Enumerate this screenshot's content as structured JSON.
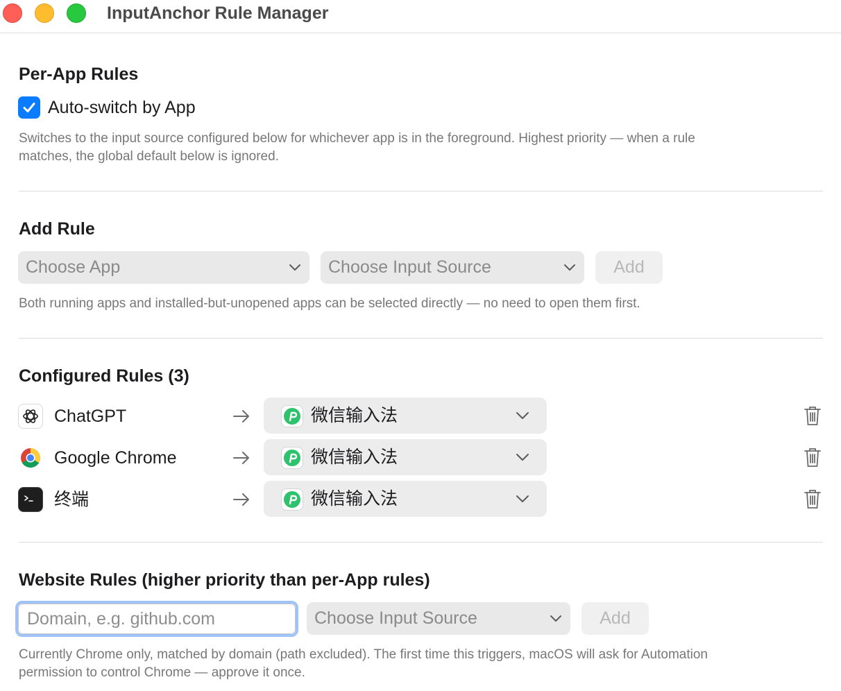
{
  "window": {
    "title": "InputAnchor Rule Manager"
  },
  "per_app": {
    "heading": "Per-App Rules",
    "checkbox_label": "Auto-switch by App",
    "checkbox_checked": true,
    "description_line1": "Switches to the input source configured below for whichever app is in the foreground. Highest priority — when a rule",
    "description_line2": "matches, the global default below is ignored."
  },
  "add_rule": {
    "heading": "Add Rule",
    "app_select": "Choose App",
    "source_select": "Choose Input Source",
    "add_label": "Add",
    "hint": "Both running apps and installed-but-unopened apps can be selected directly — no need to open them first."
  },
  "configured": {
    "heading": "Configured Rules (3)",
    "rules": [
      {
        "app": "ChatGPT",
        "icon": "chatgpt-icon",
        "source": "微信输入法"
      },
      {
        "app": "Google Chrome",
        "icon": "chrome-icon",
        "source": "微信输入法"
      },
      {
        "app": "终端",
        "icon": "terminal-icon",
        "source": "微信输入法"
      }
    ]
  },
  "website": {
    "heading": "Website Rules (higher priority than per-App rules)",
    "domain_placeholder": "Domain, e.g. github.com",
    "source_select": "Choose Input Source",
    "add_label": "Add",
    "hint_line1": "Currently Chrome only, matched by domain (path excluded). The first time this triggers, macOS will ask for Automation",
    "hint_line2": "permission to control Chrome — approve it once."
  },
  "colors": {
    "accent": "#0a7cff",
    "focus_ring": "#9fc3f6",
    "wechat_green": "#2dc26b"
  }
}
